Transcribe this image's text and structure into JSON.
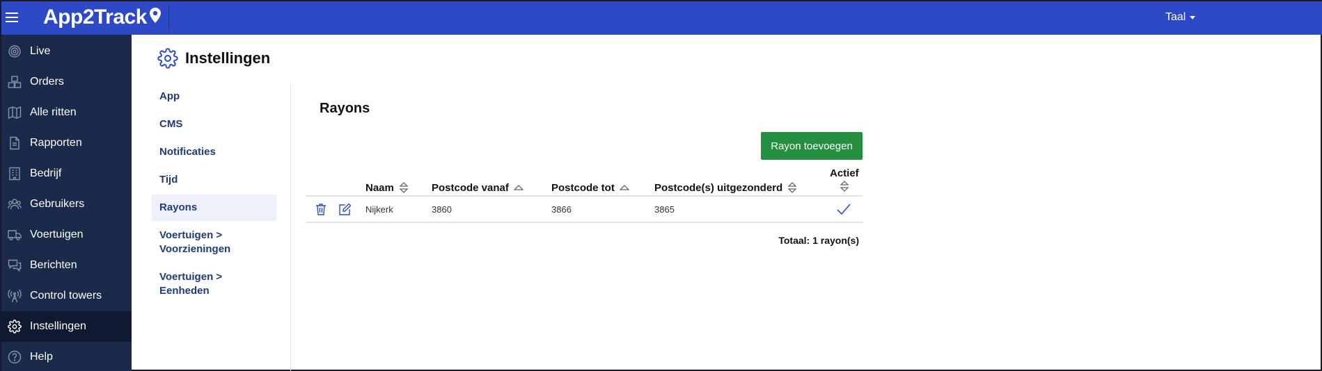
{
  "header": {
    "logo_text": "App2Track",
    "language_label": "Taal"
  },
  "sidebar": {
    "items": [
      {
        "label": "Live",
        "icon": "live-radar-icon"
      },
      {
        "label": "Orders",
        "icon": "boxes-icon"
      },
      {
        "label": "Alle ritten",
        "icon": "map-icon"
      },
      {
        "label": "Rapporten",
        "icon": "document-icon"
      },
      {
        "label": "Bedrijf",
        "icon": "building-icon"
      },
      {
        "label": "Gebruikers",
        "icon": "users-icon"
      },
      {
        "label": "Voertuigen",
        "icon": "truck-icon"
      },
      {
        "label": "Berichten",
        "icon": "chat-icon"
      },
      {
        "label": "Control towers",
        "icon": "antenna-icon"
      },
      {
        "label": "Instellingen",
        "icon": "gear-icon",
        "active": true
      },
      {
        "label": "Help",
        "icon": "help-icon"
      }
    ]
  },
  "page": {
    "title": "Instellingen"
  },
  "settings_nav": {
    "items": [
      {
        "label": "App"
      },
      {
        "label": "CMS"
      },
      {
        "label": "Notificaties"
      },
      {
        "label": "Tijd"
      },
      {
        "label": "Rayons",
        "active": true
      },
      {
        "label": "Voertuigen > Voorzieningen"
      },
      {
        "label": "Voertuigen > Eenheden"
      }
    ]
  },
  "rayons": {
    "title": "Rayons",
    "add_button": "Rayon toevoegen",
    "columns": {
      "naam": "Naam",
      "postcode_vanaf": "Postcode vanaf",
      "postcode_tot": "Postcode tot",
      "uitgezonderd": "Postcode(s) uitgezonderd",
      "actief": "Actief"
    },
    "rows": [
      {
        "naam": "Nijkerk",
        "postcode_vanaf": "3860",
        "postcode_tot": "3866",
        "uitgezonderd": "3865",
        "actief": true
      }
    ],
    "total": "Totaal: 1 rayon(s)"
  },
  "colors": {
    "topbar": "#2d49c6",
    "sidebar": "#1b2a4a",
    "sidebar_active": "#0f1a30",
    "accent": "#2d49c6",
    "button_green": "#24903f",
    "link": "#1f3a7a"
  }
}
